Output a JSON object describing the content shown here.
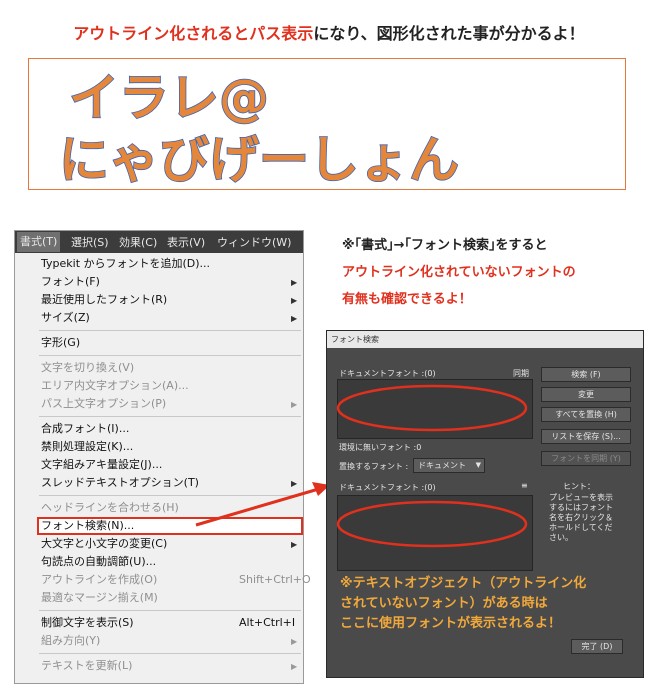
{
  "top_caption": {
    "highlight": "アウトライン化されるとパス表示",
    "rest": "になり、図形化された事が分かるよ！"
  },
  "banner": {
    "line1": "イラレ@",
    "line2": "にゃびげーしょん"
  },
  "menubar": {
    "items": [
      "書式(T)",
      "選択(S)",
      "効果(C)",
      "表示(V)",
      "ウィンドウ(W)"
    ]
  },
  "menu": {
    "items": [
      {
        "label": "Typekit からフォントを追加(D)...",
        "disabled": false
      },
      {
        "label": "フォント(F)",
        "disabled": false,
        "submenu": true
      },
      {
        "label": "最近使用したフォント(R)",
        "disabled": false,
        "submenu": true
      },
      {
        "label": "サイズ(Z)",
        "disabled": false,
        "submenu": true
      },
      {
        "label": "字形(G)",
        "disabled": false
      },
      {
        "label": "文字を切り換え(V)",
        "disabled": true
      },
      {
        "label": "エリア内文字オプション(A)...",
        "disabled": true
      },
      {
        "label": "パス上文字オプション(P)",
        "disabled": true,
        "submenu": true
      },
      {
        "label": "合成フォント(I)...",
        "disabled": false
      },
      {
        "label": "禁則処理設定(K)...",
        "disabled": false
      },
      {
        "label": "文字組みアキ量設定(J)...",
        "disabled": false
      },
      {
        "label": "スレッドテキストオプション(T)",
        "disabled": false,
        "submenu": true
      },
      {
        "label": "ヘッドラインを合わせる(H)",
        "disabled": true
      },
      {
        "label": "フォント検索(N)...",
        "disabled": false
      },
      {
        "label": "大文字と小文字の変更(C)",
        "disabled": false,
        "submenu": true
      },
      {
        "label": "句読点の自動調節(U)...",
        "disabled": false
      },
      {
        "label": "アウトラインを作成(O)",
        "disabled": true,
        "shortcut": "Shift+Ctrl+O"
      },
      {
        "label": "最適なマージン揃え(M)",
        "disabled": true
      },
      {
        "label": "制御文字を表示(S)",
        "disabled": false,
        "shortcut": "Alt+Ctrl+I"
      },
      {
        "label": "組み方向(Y)",
        "disabled": true,
        "submenu": true
      },
      {
        "label": "テキストを更新(L)",
        "disabled": true,
        "submenu": true
      }
    ]
  },
  "notes": {
    "line1": "※｢書式｣→｢フォント検索｣をすると",
    "line2": "アウトライン化されていないフォントの",
    "line3": "有無も確認できるよ！"
  },
  "dialog": {
    "title": "フォント検索",
    "doc_fonts_label": "ドキュメントフォント :(0)",
    "sync_label": "同期",
    "missing_fonts_label": "環境に無いフォント :0",
    "replace_label": "置換するフォント :",
    "replace_select": "ドキュメント",
    "doc_fonts_label2": "ドキュメントフォント :(0)",
    "buttons": {
      "search": "検索 (F)",
      "change": "変更",
      "replace_all": "すべてを置換 (H)",
      "save_list": "リストを保存 (S)...",
      "sync_fonts": "フォントを同期 (Y)",
      "done": "完了 (D)"
    },
    "hint_title": "ヒント：",
    "hint_text": [
      "プレビューを表示",
      "するにはフォント",
      "名を右クリック＆",
      "ホールドしてくだ",
      "さい。"
    ]
  },
  "dialog_note": {
    "line1": "※テキストオブジェクト（アウトライン化",
    "line2": "されていないフォント）がある時は",
    "line3": "ここに使用フォントが表示されるよ！"
  },
  "colors": {
    "accent_red": "#e0301e",
    "note_orange": "#f2a93b",
    "outline_fill": "#e5873a",
    "outline_stroke": "#3a63b8"
  }
}
